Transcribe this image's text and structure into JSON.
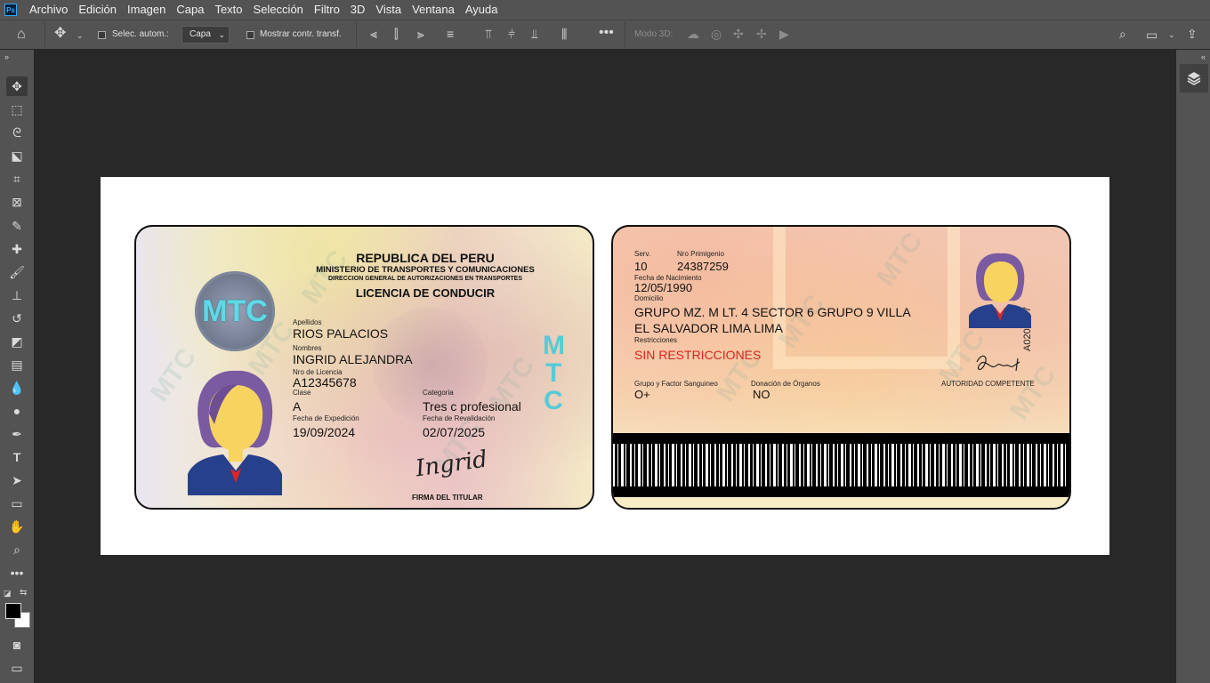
{
  "app": {
    "logo": "Ps"
  },
  "menu": [
    "Archivo",
    "Edición",
    "Imagen",
    "Capa",
    "Texto",
    "Selección",
    "Filtro",
    "3D",
    "Vista",
    "Ventana",
    "Ayuda"
  ],
  "options": {
    "auto_select_label": "Selec. autom.:",
    "auto_select_value": "Capa",
    "show_transform_label": "Mostrar contr. transf.",
    "mode_3d_label": "Modo 3D:"
  },
  "front": {
    "country": "REPUBLICA DEL PERU",
    "ministry": "MINISTERIO DE TRANSPORTES Y COMUNICACIONES",
    "direction": "DIRECCION GENERAL DE AUTORIZACIONES EN TRANSPORTES",
    "doc_title": "LICENCIA DE CONDUCIR",
    "seal_text": "MTC",
    "vertical_mtc": "MTC",
    "watermark": "MTC",
    "apellidos_label": "Apellidos",
    "apellidos": "RIOS PALACIOS",
    "nombres_label": "Nombres",
    "nombres": "INGRID ALEJANDRA",
    "licencia_label": "Nro de Licencia",
    "licencia": "A12345678",
    "clase_label": "Clase",
    "clase": "A",
    "categoria_label": "Categoria",
    "categoria": "Tres c profesional",
    "expedicion_label": "Fecha de Expedición",
    "expedicion": "19/09/2024",
    "revalidacion_label": "Fecha de Revalidación",
    "revalidacion": "02/07/2025",
    "signature": "Ingrid",
    "firma_label": "FIRMA DEL TITULAR"
  },
  "back": {
    "serv_label": "Serv.",
    "serv": "10",
    "nro_primigenio_label": "Nro Primigenio",
    "nro_primigenio": "24387259",
    "nacimiento_label": "Fecha de Nacimiento",
    "nacimiento": "12/05/1990",
    "domicilio_label": "Domicilio",
    "domicilio_1": "GRUPO MZ. M LT. 4 SECTOR 6 GRUPO 9 VILLA",
    "domicilio_2": "EL SALVADOR LIMA LIMA",
    "restricciones_label": "Restricciones",
    "restricciones": "SIN RESTRICCIONES",
    "sangre_label": "Grupo y Factor Sanguineo",
    "sangre": "O+",
    "donacion_label": "Donación de Órganos",
    "donacion": "NO",
    "autoridad": "AUTORIDAD COMPETENTE",
    "serial": "A0200247",
    "watermark": "MTC"
  },
  "colors": {
    "restriction_red": "#d7261e",
    "ps_blue": "#31a8ff"
  }
}
